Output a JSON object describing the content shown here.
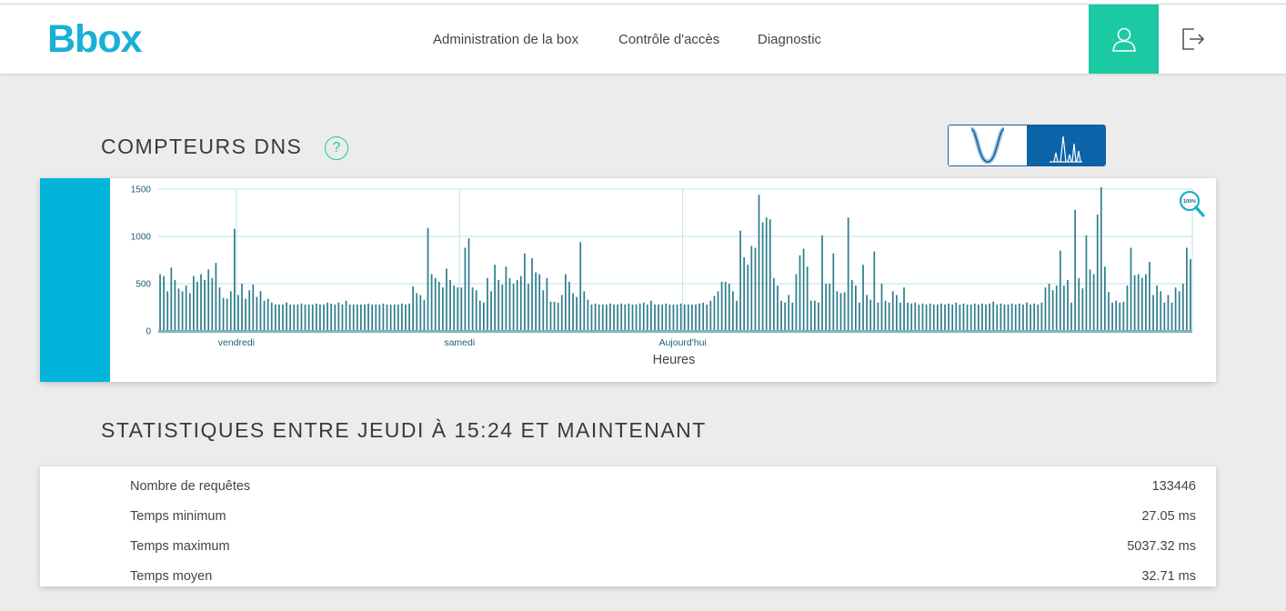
{
  "app": {
    "logo_text": "Bbox",
    "brand_color": "#1ab0d6",
    "accent_color": "#1bc9a3"
  },
  "nav": {
    "items": [
      {
        "label": "Administration de la box"
      },
      {
        "label": "Contrôle d'accès"
      },
      {
        "label": "Diagnostic"
      }
    ],
    "user_icon": "user-icon",
    "logout_icon": "logout-icon"
  },
  "dns_section": {
    "title": "COMPTEURS DNS",
    "help_label": "?",
    "view_toggle": [
      {
        "icon": "curve-view-icon",
        "selected": false
      },
      {
        "icon": "bars-view-icon",
        "selected": true
      }
    ],
    "zoom_icon": "zoom-icon",
    "zoom_badge": "100%"
  },
  "chart_data": {
    "type": "bar",
    "xlabel": "Heures",
    "ylabel": "",
    "ylim": [
      0,
      1500
    ],
    "yticks": [
      0,
      500,
      1000,
      1500
    ],
    "day_labels": [
      {
        "label": "vendredi",
        "index": 21
      },
      {
        "label": "samedi",
        "index": 81
      },
      {
        "label": "Aujourd'hui",
        "index": 141
      }
    ],
    "grid": true,
    "bar_color": "#2e7d8c",
    "values": [
      600,
      580,
      420,
      670,
      540,
      450,
      420,
      480,
      400,
      580,
      520,
      600,
      540,
      650,
      560,
      720,
      460,
      350,
      340,
      420,
      1080,
      380,
      500,
      340,
      430,
      490,
      360,
      420,
      320,
      340,
      300,
      280,
      280,
      280,
      300,
      280,
      280,
      280,
      290,
      280,
      280,
      280,
      290,
      280,
      280,
      300,
      290,
      280,
      300,
      280,
      320,
      280,
      280,
      280,
      280,
      280,
      290,
      280,
      280,
      280,
      290,
      280,
      280,
      280,
      280,
      290,
      280,
      290,
      470,
      400,
      380,
      330,
      1090,
      600,
      560,
      520,
      460,
      660,
      540,
      480,
      460,
      460,
      880,
      980,
      460,
      430,
      320,
      300,
      560,
      420,
      700,
      540,
      490,
      680,
      560,
      500,
      540,
      580,
      820,
      500,
      770,
      620,
      600,
      430,
      560,
      310,
      310,
      300,
      380,
      600,
      520,
      400,
      360,
      940,
      420,
      330,
      280,
      290,
      280,
      280,
      280,
      290,
      280,
      280,
      290,
      280,
      290,
      280,
      280,
      290,
      300,
      280,
      320,
      280,
      280,
      280,
      290,
      280,
      280,
      280,
      290,
      280,
      280,
      280,
      280,
      290,
      300,
      280,
      320,
      370,
      420,
      520,
      520,
      500,
      420,
      320,
      1060,
      780,
      700,
      900,
      880,
      1440,
      1150,
      1200,
      1180,
      560,
      480,
      320,
      300,
      380,
      300,
      600,
      800,
      870,
      680,
      320,
      320,
      300,
      1010,
      500,
      500,
      820,
      420,
      400,
      410,
      1200,
      540,
      480,
      300,
      700,
      380,
      330,
      840,
      300,
      500,
      320,
      300,
      420,
      380,
      300,
      460,
      300,
      290,
      300,
      280,
      290,
      280,
      290,
      280,
      280,
      290,
      280,
      290,
      280,
      300,
      280,
      290,
      280,
      280,
      290,
      280,
      290,
      280,
      290,
      310,
      280,
      290,
      280,
      280,
      290,
      280,
      290,
      280,
      300,
      280,
      290,
      280,
      300,
      460,
      500,
      430,
      480,
      850,
      480,
      540,
      300,
      1280,
      560,
      450,
      1010,
      650,
      600,
      1230,
      1520,
      680,
      410,
      300,
      320,
      300,
      310,
      480,
      880,
      590,
      600,
      560,
      600,
      730,
      380,
      480,
      420,
      300,
      380,
      300,
      460,
      420,
      500,
      880,
      760
    ]
  },
  "stats_section": {
    "title": "STATISTIQUES ENTRE JEUDI À 15:24 ET MAINTENANT",
    "rows": [
      {
        "label": "Nombre de requêtes",
        "value": "133446"
      },
      {
        "label": "Temps minimum",
        "value": "27.05 ms"
      },
      {
        "label": "Temps maximum",
        "value": "5037.32 ms"
      },
      {
        "label": "Temps moyen",
        "value": "32.71 ms"
      }
    ]
  }
}
